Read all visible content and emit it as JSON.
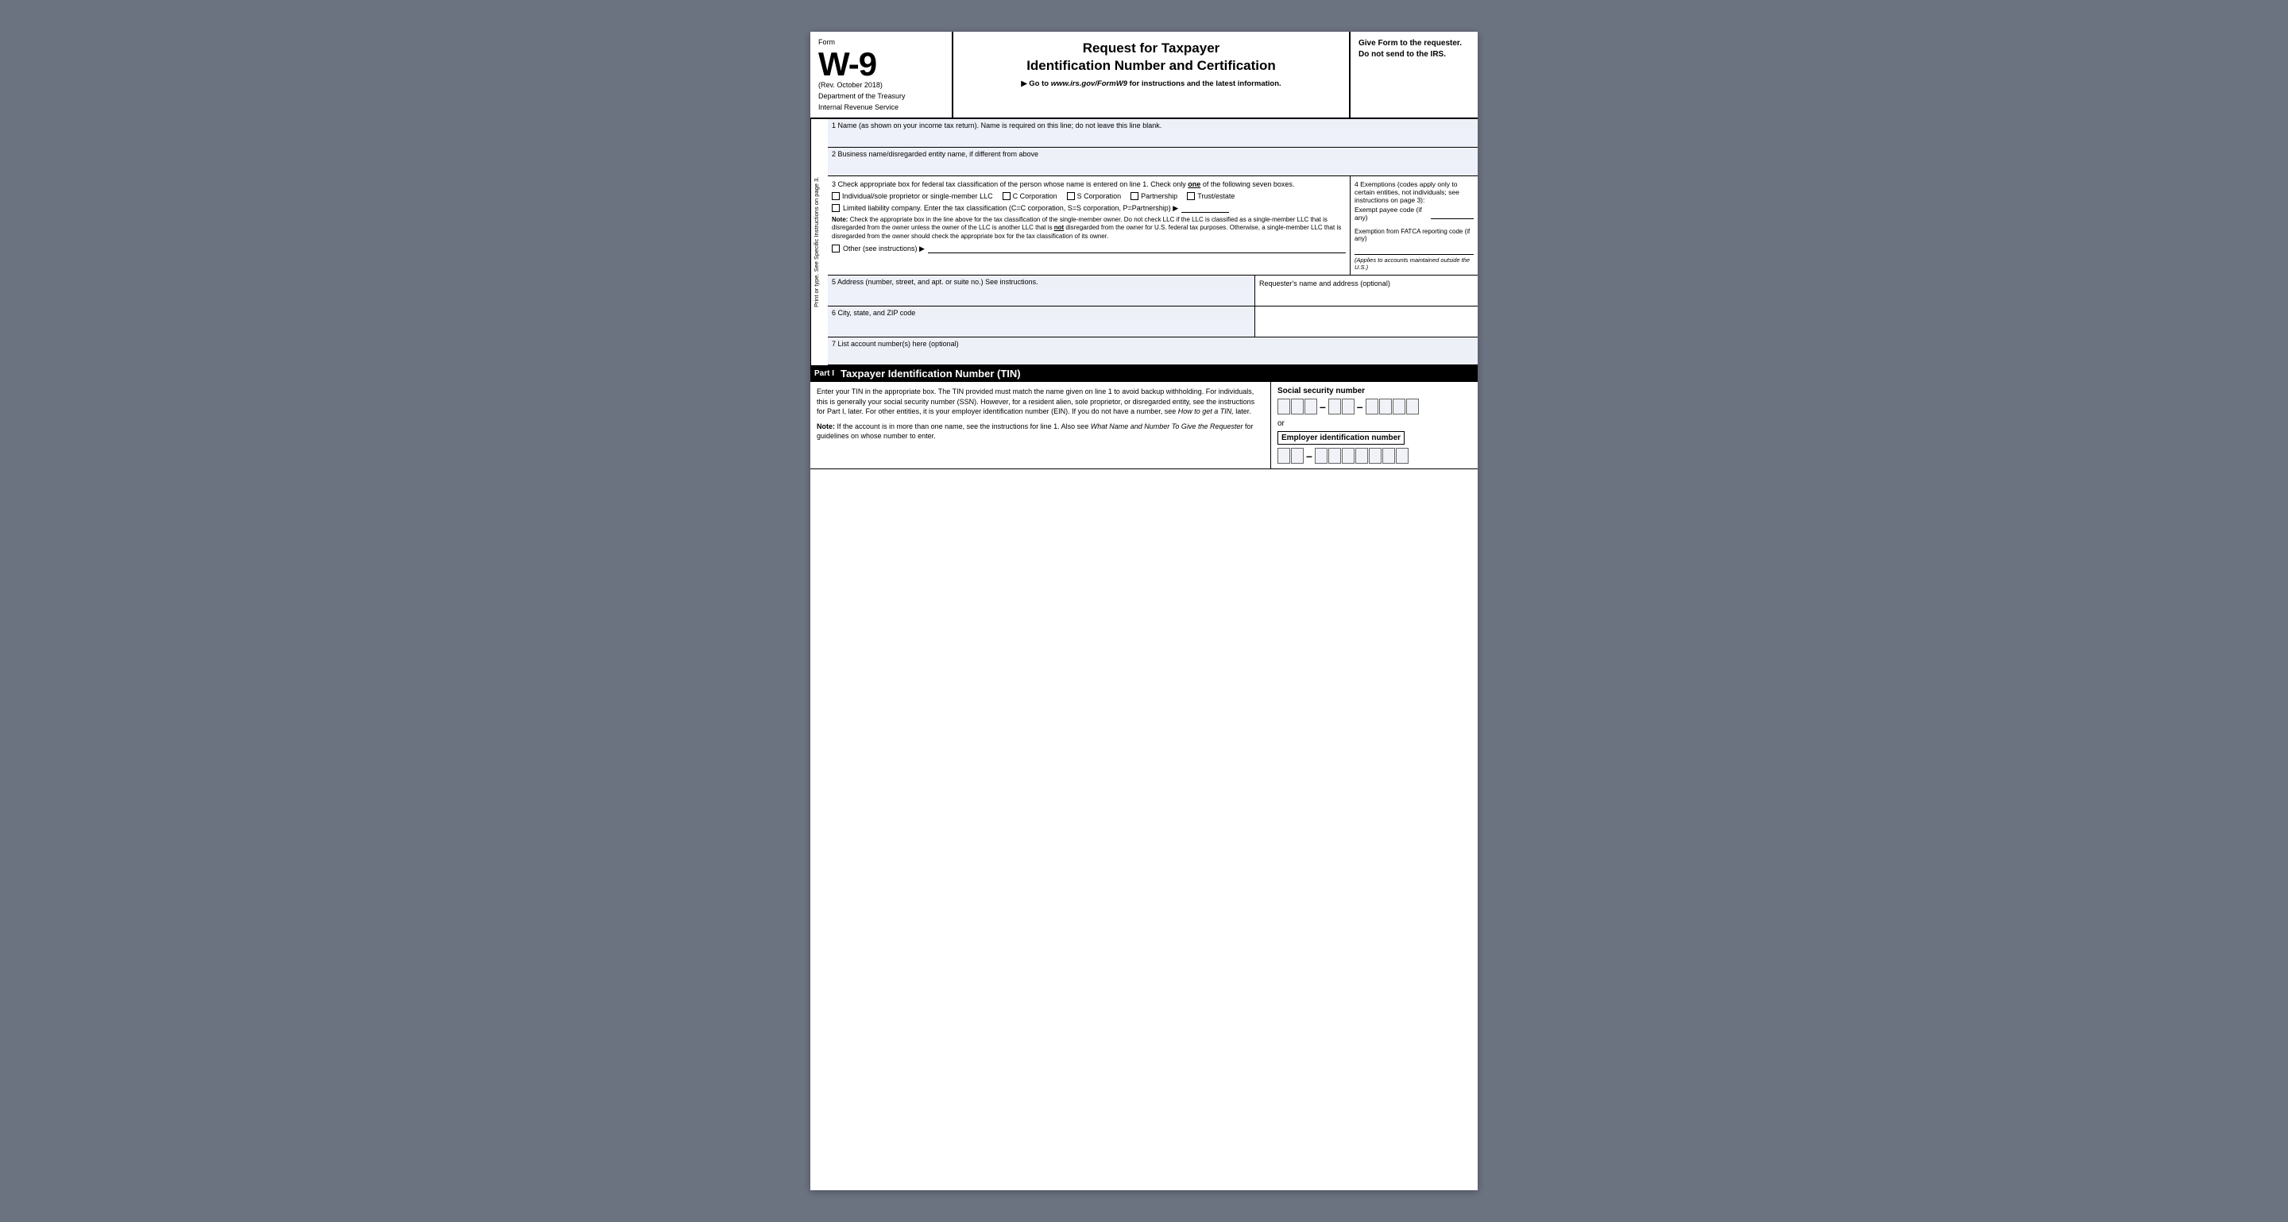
{
  "form": {
    "number": "W-9",
    "label": "Form",
    "rev": "(Rev. October 2018)",
    "dept1": "Department of the Treasury",
    "dept2": "Internal Revenue Service",
    "title_line1": "Request for Taxpayer",
    "title_line2": "Identification Number and Certification",
    "url_text": "▶ Go to www.irs.gov/FormW9 for instructions and the latest information.",
    "give_form": "Give Form to the requester. Do not send to the IRS.",
    "side_label": "Print or type.   See Specific Instructions on page 3."
  },
  "fields": {
    "field1_label": "1  Name (as shown on your income tax return). Name is required on this line; do not leave this line blank.",
    "field2_label": "2  Business name/disregarded entity name, if different from above",
    "field3_label": "3  Check appropriate box for federal tax classification of the person whose name is entered on line 1. Check only",
    "field3_label_bold": "one",
    "field3_label2": "of the following seven boxes.",
    "cb_individual": "Individual/sole proprietor or single-member LLC",
    "cb_c_corp": "C Corporation",
    "cb_s_corp": "S Corporation",
    "cb_partnership": "Partnership",
    "cb_trust": "Trust/estate",
    "cb_llc_label": "Limited liability company. Enter the tax classification (C=C corporation, S=S corporation, P=Partnership) ▶",
    "note_label": "Note:",
    "note_text": "Check the appropriate box in the line above for the tax classification of the single-member owner.  Do not check LLC if the LLC is classified as a single-member LLC that is disregarded from the owner unless the owner of the LLC is another LLC that is",
    "note_not": "not",
    "note_text2": "disregarded from the owner for U.S. federal tax purposes. Otherwise, a single-member LLC that is disregarded from the owner should check the appropriate box for the tax classification of its owner.",
    "cb_other": "Other (see instructions) ▶",
    "exemptions_label": "4  Exemptions (codes apply only to certain entities, not individuals; see instructions on page 3):",
    "exempt_payee_label": "Exempt payee code (if any)",
    "fatca_label": "Exemption from FATCA reporting code (if any)",
    "applies_text": "(Applies to accounts maintained outside the U.S.)",
    "field5_label": "5  Address (number, street, and apt. or suite no.) See instructions.",
    "requester_label": "Requester's name and address (optional)",
    "field6_label": "6  City, state, and ZIP code",
    "field7_label": "7  List account number(s) here (optional)"
  },
  "part1": {
    "label": "Part I",
    "title": "Taxpayer Identification Number (TIN)",
    "body_text1": "Enter your TIN in the appropriate box. The TIN provided must match the name given on line 1 to avoid backup withholding. For individuals, this is generally your social security number (SSN). However, for a resident alien, sole proprietor, or disregarded entity, see the instructions for Part I, later. For other entities, it is your employer identification number (EIN). If you do not have a number, see",
    "how_to_get": "How to get a TIN,",
    "body_text2": "later.",
    "note_label": "Note:",
    "note_body": "If the account is in more than one name, see the instructions for line 1. Also see",
    "what_name": "What Name and Number To Give the Requester",
    "note_body2": "for guidelines on whose number to enter.",
    "ssn_label": "Social security number",
    "ssn_dash1": "–",
    "ssn_dash2": "–",
    "or_text": "or",
    "ein_label": "Employer identification number",
    "ein_dash": "–"
  }
}
